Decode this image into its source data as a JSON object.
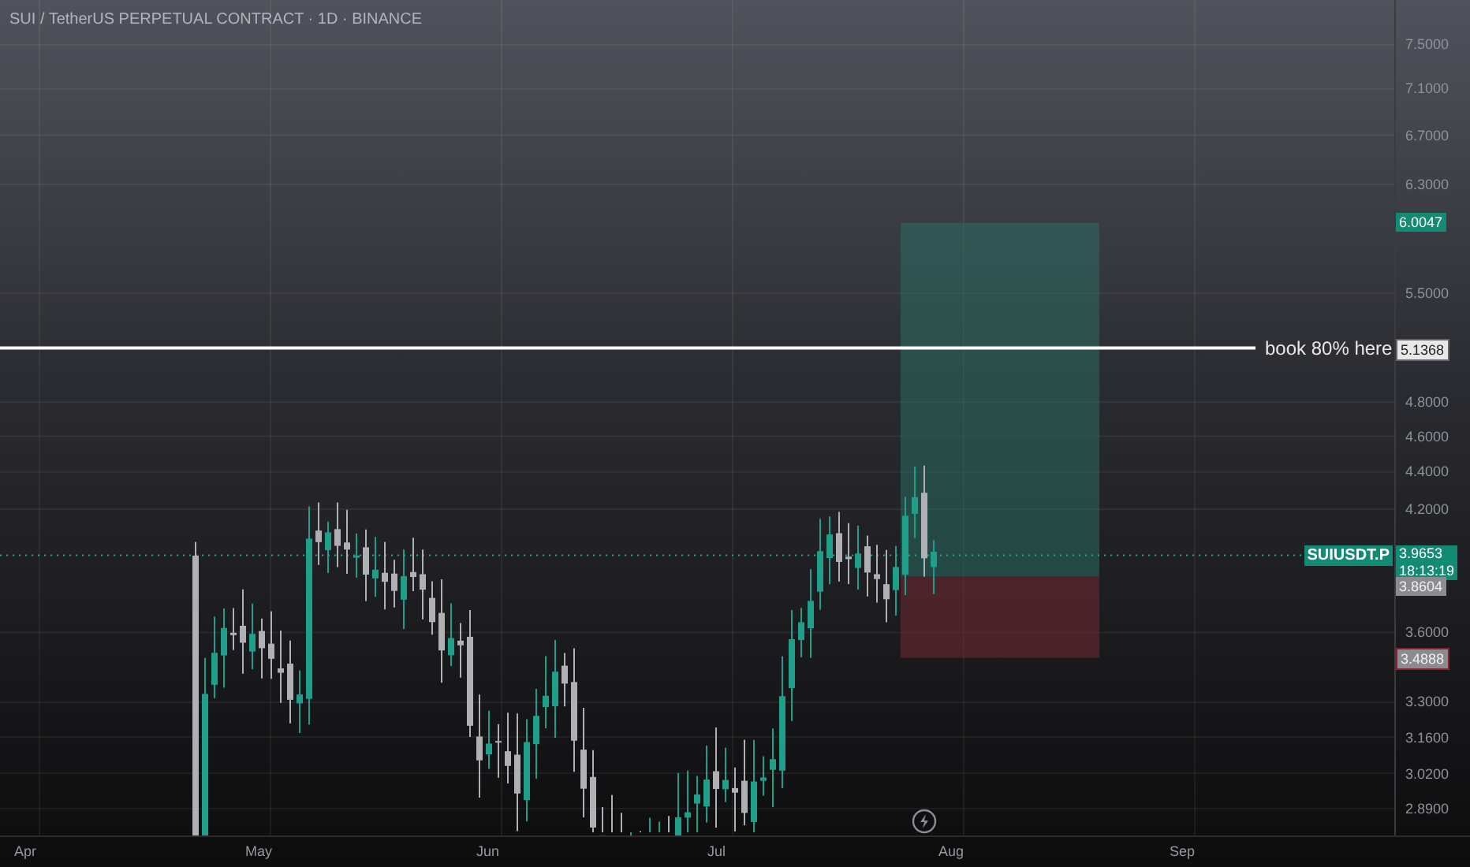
{
  "chart_title": "SUI / TetherUS PERPETUAL CONTRACT · 1D · BINANCE",
  "price_axis": [
    "7.5000",
    "7.1000",
    "6.7000",
    "6.3000",
    "5.5000",
    "4.8000",
    "4.6000",
    "4.4000",
    "4.2000",
    "3.6000",
    "3.3000",
    "3.1600",
    "3.0200",
    "2.8900"
  ],
  "time_axis": [
    "Apr",
    "May",
    "Jun",
    "Jul",
    "Aug",
    "Sep"
  ],
  "target_tag": "6.0047",
  "horizontal_line": {
    "label": "book 80% here",
    "price": "5.1368"
  },
  "symbol_tag": "SUIUSDT.P",
  "last_price_tag": {
    "price": "3.9653",
    "countdown": "18:13:19"
  },
  "entry_tag": "3.8604",
  "stop_tag": "3.4888"
}
